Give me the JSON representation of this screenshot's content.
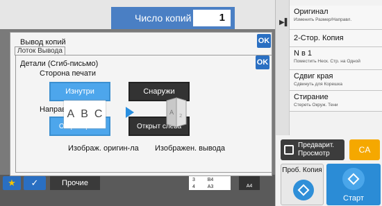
{
  "copies": {
    "label": "Число копий",
    "value": "1"
  },
  "right_panel": {
    "items": [
      {
        "main": "Оригинал",
        "sub": "Изменить Размер/Направл."
      },
      {
        "main": "2-Стор. Копия",
        "sub": ""
      },
      {
        "main": "N в 1",
        "sub": "Поместить Неск. Стр. на Одной"
      },
      {
        "main": "Сдвиг края",
        "sub": "Сдвинуть для Корешка"
      },
      {
        "main": "Стирание",
        "sub": "Стереть Окруж. Тени"
      }
    ]
  },
  "actions": {
    "preview_line1": "Предварит.",
    "preview_line2": "Просмотр",
    "ca": "CA",
    "probe_copy": "Проб. Копия",
    "start": "Старт"
  },
  "bottom": {
    "other": "Прочие",
    "tray": [
      {
        "num": "3",
        "size": "B4"
      },
      {
        "num": "4",
        "size": "A3"
      }
    ],
    "paper": "A4"
  },
  "dialog_output": {
    "title": "Вывод копий",
    "subtitle": "Лоток Вывода",
    "ok": "OK"
  },
  "dialog_details": {
    "title": "Детали (Сгиб-письмо)",
    "ok": "OK",
    "print_side_label": "Сторона печати",
    "print_side_options": [
      "Изнутри",
      "Снаружи"
    ],
    "print_side_selected": "Изнутри",
    "open_dir_label": "Направл. открыв.",
    "open_dir_options": [
      "Откр. справа",
      "Открыт слева"
    ],
    "open_dir_selected": "Откр. справа",
    "orig_image_label": "Изображ. оригин-ла",
    "output_image_label": "Изображен. вывода",
    "orig_letters": [
      "A",
      "B",
      "C"
    ]
  },
  "colors": {
    "accent": "#2a6fc2",
    "selected": "#4da6ec",
    "ca": "#f5a800",
    "start": "#2b8cd6"
  }
}
